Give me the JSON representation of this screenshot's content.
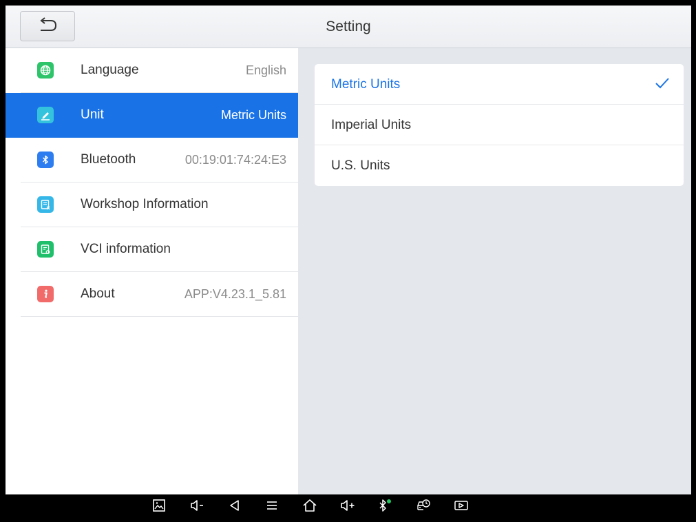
{
  "header": {
    "title": "Setting"
  },
  "sidebar": {
    "items": [
      {
        "label": "Language",
        "value": "English",
        "icon": "globe-icon",
        "color": "#2dc46a"
      },
      {
        "label": "Unit",
        "value": "Metric Units",
        "icon": "pencil-icon",
        "color": "#34c3dd",
        "active": true
      },
      {
        "label": "Bluetooth",
        "value": "00:19:01:74:24:E3",
        "icon": "bluetooth-icon",
        "color": "#2e7df0"
      },
      {
        "label": "Workshop Information",
        "value": "",
        "icon": "workshop-document-icon",
        "color": "#35b7e8"
      },
      {
        "label": "VCI information",
        "value": "",
        "icon": "vci-document-icon",
        "color": "#1fbf6b"
      },
      {
        "label": "About",
        "value": "APP:V4.23.1_5.81",
        "icon": "info-icon",
        "color": "#f26b6b"
      }
    ]
  },
  "units": {
    "options": [
      {
        "label": "Metric Units",
        "selected": true
      },
      {
        "label": "Imperial Units",
        "selected": false
      },
      {
        "label": "U.S. Units",
        "selected": false
      }
    ]
  },
  "navbar": {
    "icons": [
      "screenshot-icon",
      "volume-down-icon",
      "back-icon",
      "menu-icon",
      "home-icon",
      "volume-up-icon",
      "bluetooth-status-icon",
      "car-diagnostic-icon",
      "screen-record-icon"
    ]
  },
  "colors": {
    "accent": "#1a73e6",
    "pane_bg": "#e4e7ec",
    "bluetooth_connected": "#22c55e"
  }
}
